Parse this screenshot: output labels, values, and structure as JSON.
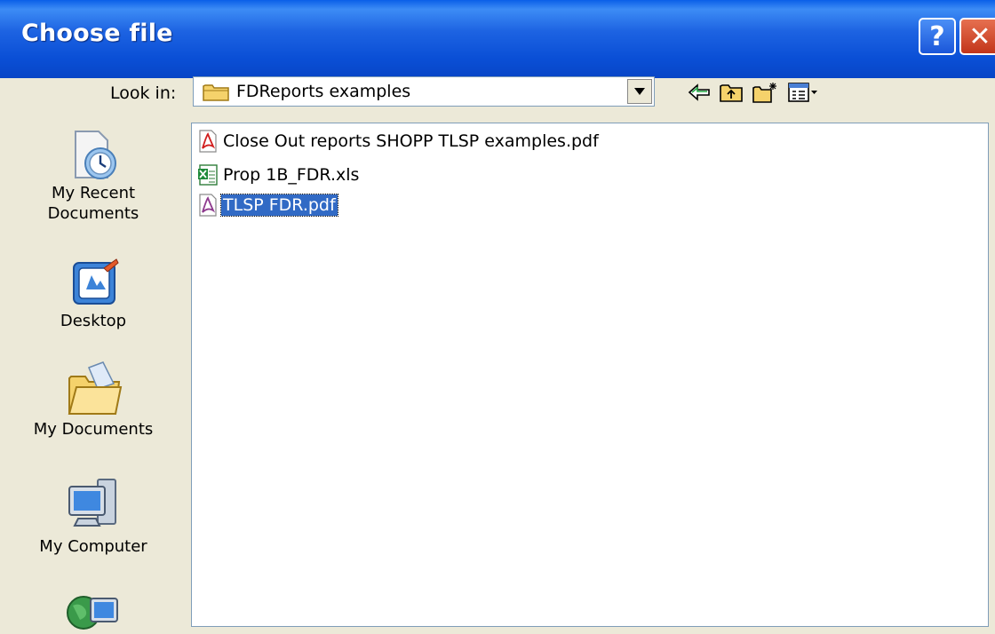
{
  "dialog": {
    "title": "Choose file",
    "help_button_glyph": "?",
    "close_button_glyph": "✕"
  },
  "lookin": {
    "label": "Look in:",
    "value": "FDReports examples"
  },
  "places": [
    {
      "label_line1": "My Recent",
      "label_line2": "Documents",
      "icon": "recent-documents-icon"
    },
    {
      "label_line1": "Desktop",
      "label_line2": "",
      "icon": "desktop-icon"
    },
    {
      "label_line1": "My Documents",
      "label_line2": "",
      "icon": "my-documents-icon"
    },
    {
      "label_line1": "My Computer",
      "label_line2": "",
      "icon": "my-computer-icon"
    },
    {
      "label_line1": "",
      "label_line2": "",
      "icon": "network-places-icon"
    }
  ],
  "files": [
    {
      "name": "Close Out reports SHOPP TLSP examples.pdf",
      "type": "pdf",
      "selected": false
    },
    {
      "name": "Prop 1B_FDR.xls",
      "type": "xls",
      "selected": false
    },
    {
      "name": "TLSP FDR.pdf",
      "type": "pdf",
      "selected": true
    }
  ],
  "colors": {
    "titlebar": "#0a4fd6",
    "selection": "#316ac5",
    "dialog_bg": "#ece9d8"
  }
}
